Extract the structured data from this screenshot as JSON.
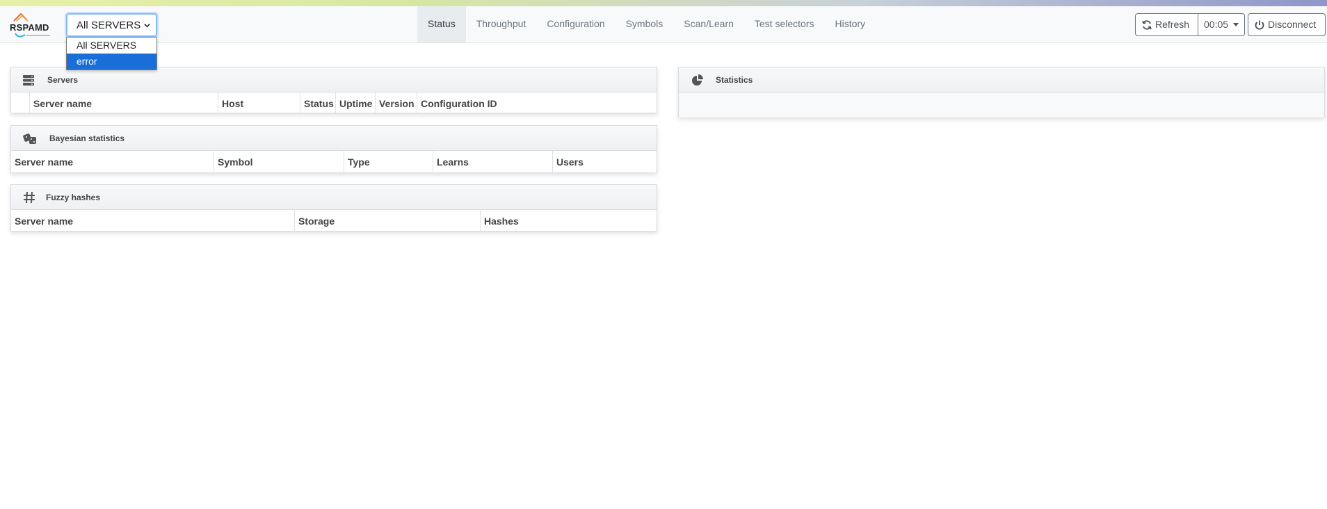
{
  "app": {
    "logo_text": "RSPAMD"
  },
  "server_select": {
    "value": "All SERVERS",
    "options": [
      "All SERVERS",
      "error"
    ],
    "highlighted": "error"
  },
  "nav": {
    "tabs": [
      {
        "label": "Status",
        "active": true
      },
      {
        "label": "Throughput"
      },
      {
        "label": "Configuration"
      },
      {
        "label": "Symbols"
      },
      {
        "label": "Scan/Learn"
      },
      {
        "label": "Test selectors"
      },
      {
        "label": "History"
      }
    ]
  },
  "toolbar": {
    "refresh_label": "Refresh",
    "interval_label": "00:05",
    "disconnect_label": "Disconnect"
  },
  "panels": {
    "servers": {
      "title": "Servers",
      "columns": [
        "",
        "Server name",
        "Host",
        "Status",
        "Uptime",
        "Version",
        "Configuration ID"
      ]
    },
    "bayes": {
      "title": "Bayesian statistics",
      "columns": [
        "Server name",
        "Symbol",
        "Type",
        "Learns",
        "Users"
      ]
    },
    "fuzzy": {
      "title": "Fuzzy hashes",
      "columns": [
        "Server name",
        "Storage",
        "Hashes"
      ]
    },
    "statistics": {
      "title": "Statistics"
    }
  },
  "colors": {
    "accent": "#1a6ed8",
    "select_focus": "#86b7fe",
    "active_tab_bg": "#e9ecef"
  }
}
